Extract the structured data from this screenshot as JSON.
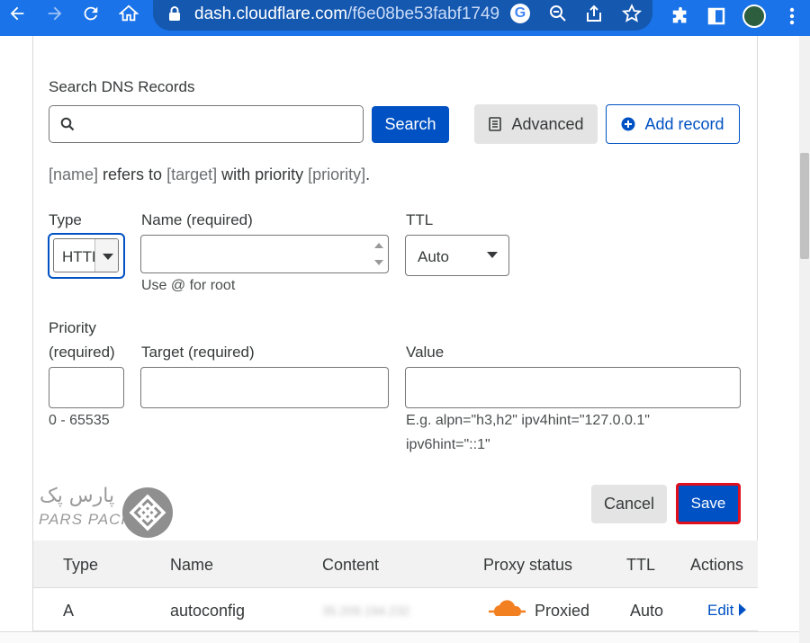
{
  "browser": {
    "url_host": "dash.cloudflare.com",
    "url_path": "/f6e08be53fabf1749..."
  },
  "search": {
    "label": "Search DNS Records",
    "placeholder": "",
    "button": "Search",
    "advanced": "Advanced",
    "add_record": "Add record"
  },
  "syntax": {
    "name": "[name]",
    "t1": " refers to ",
    "target": "[target]",
    "t2": " with priority ",
    "priority": "[priority]",
    "t3": "."
  },
  "form": {
    "type_label": "Type",
    "type_value": "HTTPS",
    "name_label": "Name (required)",
    "name_value": "",
    "name_hint": "Use @ for root",
    "ttl_label": "TTL",
    "ttl_value": "Auto",
    "priority_label_1": "Priority",
    "priority_label_2": "(required)",
    "priority_value": "",
    "priority_hint": "0 - 65535",
    "target_label": "Target (required)",
    "target_value": "",
    "value_label": "Value",
    "value_value": "",
    "value_hint_1": "E.g. alpn=\"h3,h2\" ipv4hint=\"127.0.0.1\"",
    "value_hint_2": "ipv6hint=\"::1\"",
    "cancel": "Cancel",
    "save": "Save"
  },
  "watermark": {
    "fa": "پارس پک",
    "en": "PARS PACK"
  },
  "table": {
    "headers": [
      "Type",
      "Name",
      "Content",
      "Proxy status",
      "TTL",
      "Actions"
    ],
    "rows": [
      {
        "type": "A",
        "name": "autoconfig",
        "content": "35.209.194.232",
        "proxy": "Proxied",
        "ttl": "Auto",
        "action": "Edit"
      }
    ]
  },
  "colors": {
    "browser_bar": "#1a73e8",
    "primary": "#0051c3",
    "save_outline": "#e0101e",
    "cloud": "#f38020"
  }
}
